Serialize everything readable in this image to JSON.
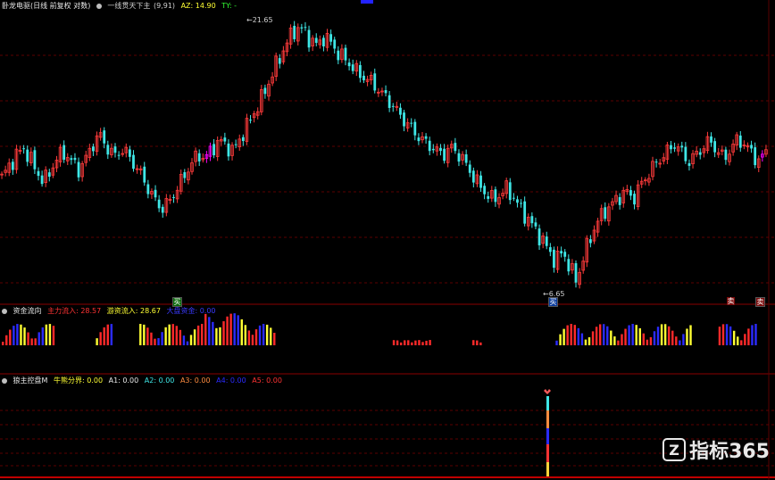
{
  "panels": {
    "main": {
      "title": "卧龙电驱(日线 前复权 对数)",
      "indicator": "一线贯天下主",
      "indicator_params": "(9,91)",
      "az_label": "AZ: 14.90",
      "ty_label": "TY: -",
      "high_label": "21.65",
      "low_label": "6.65",
      "low_arrow": "←",
      "high_arrow": "←",
      "sig_left": "买",
      "sig_mid": "买",
      "sig_right1": "卖",
      "sig_right2": "卖"
    },
    "flow": {
      "title": "资金流向",
      "main_in": "主力流入: 28.57",
      "ret_in": "游资流入: 28.67",
      "inst_in": "大盘资金: 0.00"
    },
    "bottom": {
      "title": "狼主控盘M",
      "l1": "牛熊分界: 0.00",
      "l2": "A1: 0.00",
      "l3": "A2: 0.00",
      "l4": "A3: 0.00",
      "l5": "A4: 0.00",
      "l6": "A5: 0.00"
    }
  },
  "brand": {
    "logo_text": "指标365",
    "logo_mark": "Z"
  },
  "colors": {
    "up": "#ff3b3b",
    "down": "#3fe6e6",
    "magenta": "#ff00ff",
    "grid": "#7a0000",
    "blue": "#2b2bff",
    "yellow": "#ffff33",
    "red": "#ff2a2a"
  },
  "chart_data": {
    "type": "candlestick",
    "title": "卧龙电驱(日线 前复权 对数)",
    "x": "trading days",
    "price_annotations": {
      "high": 21.65,
      "low": 6.65
    },
    "ohlc_close_path": [
      10.8,
      11.4,
      11.9,
      12.4,
      11.8,
      11.1,
      10.6,
      11.2,
      11.9,
      12.1,
      11.6,
      11.2,
      11.8,
      12.6,
      13.1,
      12.4,
      11.9,
      12.3,
      12.0,
      11.4,
      10.9,
      10.2,
      9.7,
      9.4,
      9.8,
      10.3,
      10.9,
      11.5,
      12.0,
      11.8,
      12.3,
      12.8,
      12.5,
      12.2,
      12.9,
      13.7,
      14.5,
      15.4,
      16.5,
      17.8,
      19.0,
      20.3,
      21.2,
      21.0,
      20.1,
      19.6,
      20.4,
      19.8,
      18.9,
      18.4,
      17.8,
      17.2,
      16.9,
      16.5,
      15.9,
      15.4,
      14.8,
      14.2,
      13.7,
      13.2,
      12.8,
      12.5,
      12.2,
      12.0,
      12.4,
      12.1,
      11.6,
      11.0,
      10.5,
      10.1,
      9.8,
      10.0,
      10.3,
      9.9,
      9.4,
      9.0,
      8.6,
      8.2,
      7.8,
      7.4,
      7.8,
      7.2,
      6.8,
      7.6,
      8.3,
      8.9,
      9.3,
      9.6,
      9.9,
      10.2,
      9.8,
      10.4,
      10.9,
      11.4,
      11.8,
      12.2,
      12.6,
      12.1,
      11.6,
      12.0,
      12.4,
      12.8,
      12.2,
      11.8,
      12.3,
      12.9,
      12.5,
      12.1,
      11.6,
      12.2
    ],
    "flow_bars": "blue/yellow/red histogram",
    "bottom_spike_index": 84
  }
}
